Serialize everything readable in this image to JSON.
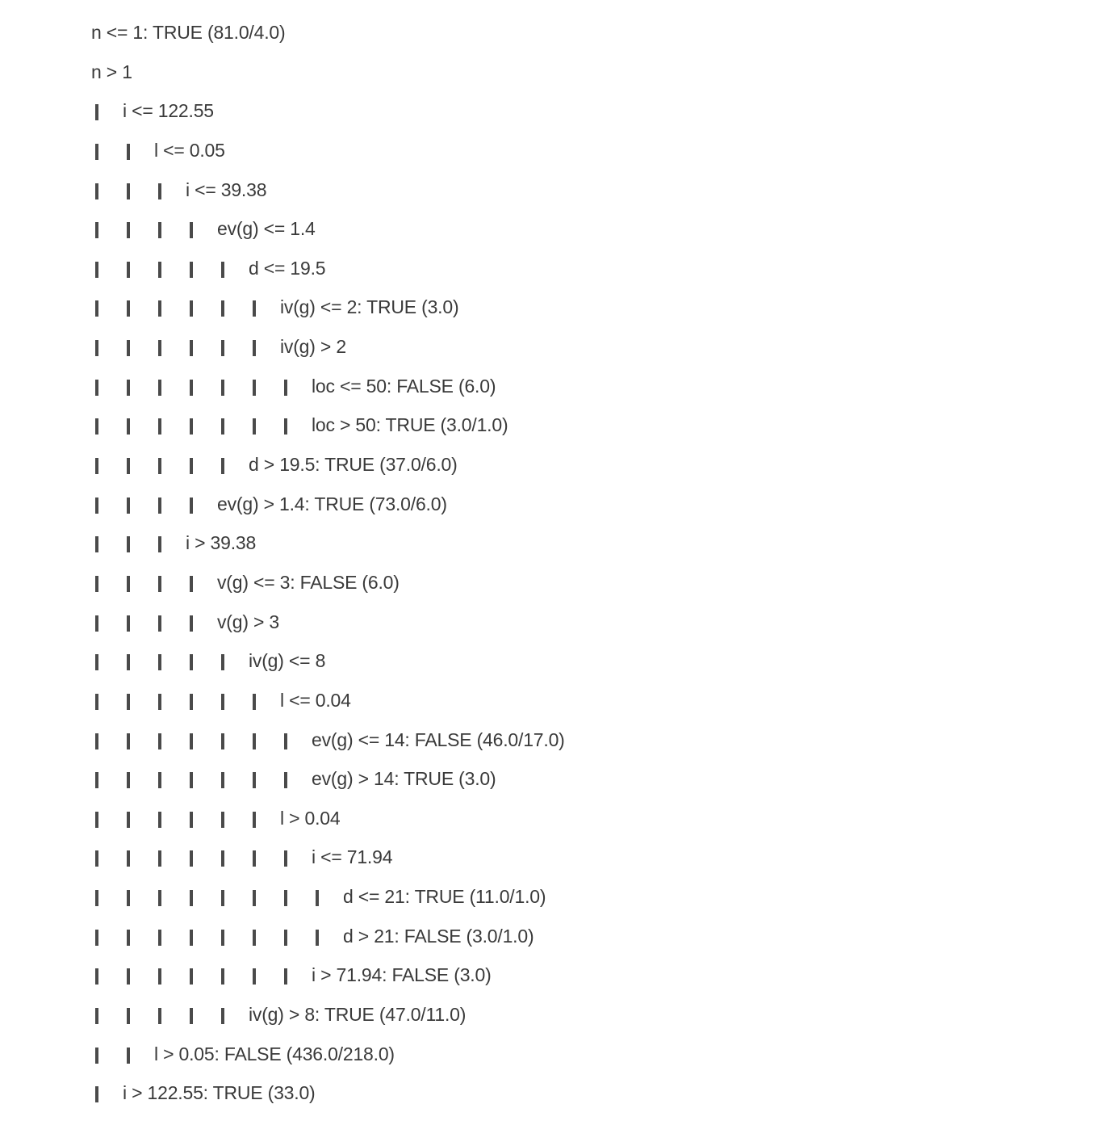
{
  "tree_lines": [
    {
      "depth": 0,
      "text": "n <= 1: TRUE (81.0/4.0)"
    },
    {
      "depth": 0,
      "text": "n > 1"
    },
    {
      "depth": 1,
      "text": "i <= 122.55"
    },
    {
      "depth": 2,
      "text": "l <= 0.05"
    },
    {
      "depth": 3,
      "text": "i <= 39.38"
    },
    {
      "depth": 4,
      "text": "ev(g) <= 1.4"
    },
    {
      "depth": 5,
      "text": "d <= 19.5"
    },
    {
      "depth": 6,
      "text": "iv(g) <= 2: TRUE (3.0)"
    },
    {
      "depth": 6,
      "text": "iv(g) > 2"
    },
    {
      "depth": 7,
      "text": "loc <= 50: FALSE (6.0)"
    },
    {
      "depth": 7,
      "text": "loc > 50: TRUE (3.0/1.0)"
    },
    {
      "depth": 5,
      "text": "d > 19.5: TRUE (37.0/6.0)"
    },
    {
      "depth": 4,
      "text": "ev(g) > 1.4: TRUE (73.0/6.0)"
    },
    {
      "depth": 3,
      "text": "i > 39.38"
    },
    {
      "depth": 4,
      "text": "v(g) <= 3: FALSE (6.0)"
    },
    {
      "depth": 4,
      "text": "v(g) > 3"
    },
    {
      "depth": 5,
      "text": "iv(g) <= 8"
    },
    {
      "depth": 6,
      "text": "l <= 0.04"
    },
    {
      "depth": 7,
      "text": "ev(g) <= 14: FALSE (46.0/17.0)"
    },
    {
      "depth": 7,
      "text": "ev(g) > 14: TRUE (3.0)"
    },
    {
      "depth": 6,
      "text": "l > 0.04"
    },
    {
      "depth": 7,
      "text": "i <= 71.94"
    },
    {
      "depth": 8,
      "text": "d <= 21: TRUE (11.0/1.0)"
    },
    {
      "depth": 8,
      "text": "d > 21: FALSE (3.0/1.0)"
    },
    {
      "depth": 7,
      "text": "i > 71.94: FALSE (3.0)"
    },
    {
      "depth": 5,
      "text": "iv(g) > 8: TRUE (47.0/11.0)"
    },
    {
      "depth": 2,
      "text": "l > 0.05: FALSE (436.0/218.0)"
    },
    {
      "depth": 1,
      "text": "i > 122.55: TRUE (33.0)"
    }
  ]
}
